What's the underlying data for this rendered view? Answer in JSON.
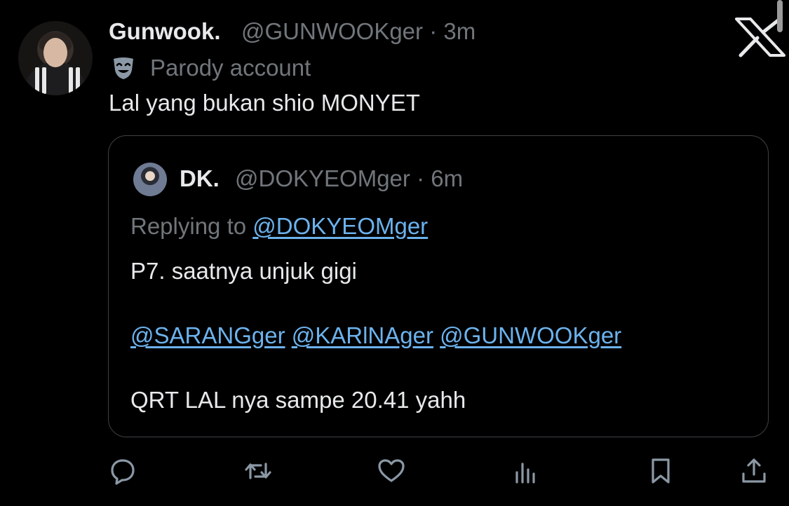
{
  "tweet": {
    "author_name": "Gunwook.",
    "author_handle": "@GUNWOOKger",
    "separator": "·",
    "time": "3m",
    "parody_label": "Parody account",
    "text": "Lal yang bukan shio MONYET"
  },
  "quoted_tweet": {
    "author_name": "DK.",
    "author_handle": "@DOKYEOMger",
    "separator": "·",
    "time": "6m",
    "replying_prefix": "Replying to",
    "replying_to": "@DOKYEOMger",
    "line1": "P7. saatnya unjuk gigi",
    "mentions": [
      "@SARANGger",
      "@KARlNAger",
      "@GUNWOOKger"
    ],
    "line3": "QRT LAL nya sampe 20.41 yahh"
  },
  "icons": {
    "parody": "theater-mask-icon",
    "app": "x-logo-icon",
    "actions": [
      "reply-icon",
      "repost-icon",
      "like-icon",
      "views-icon",
      "bookmark-icon",
      "share-icon"
    ]
  },
  "colors": {
    "background": "#000000",
    "text": "#e7e9ea",
    "secondary": "#71767b",
    "link": "#6cb2ed",
    "border": "#3e4144"
  }
}
